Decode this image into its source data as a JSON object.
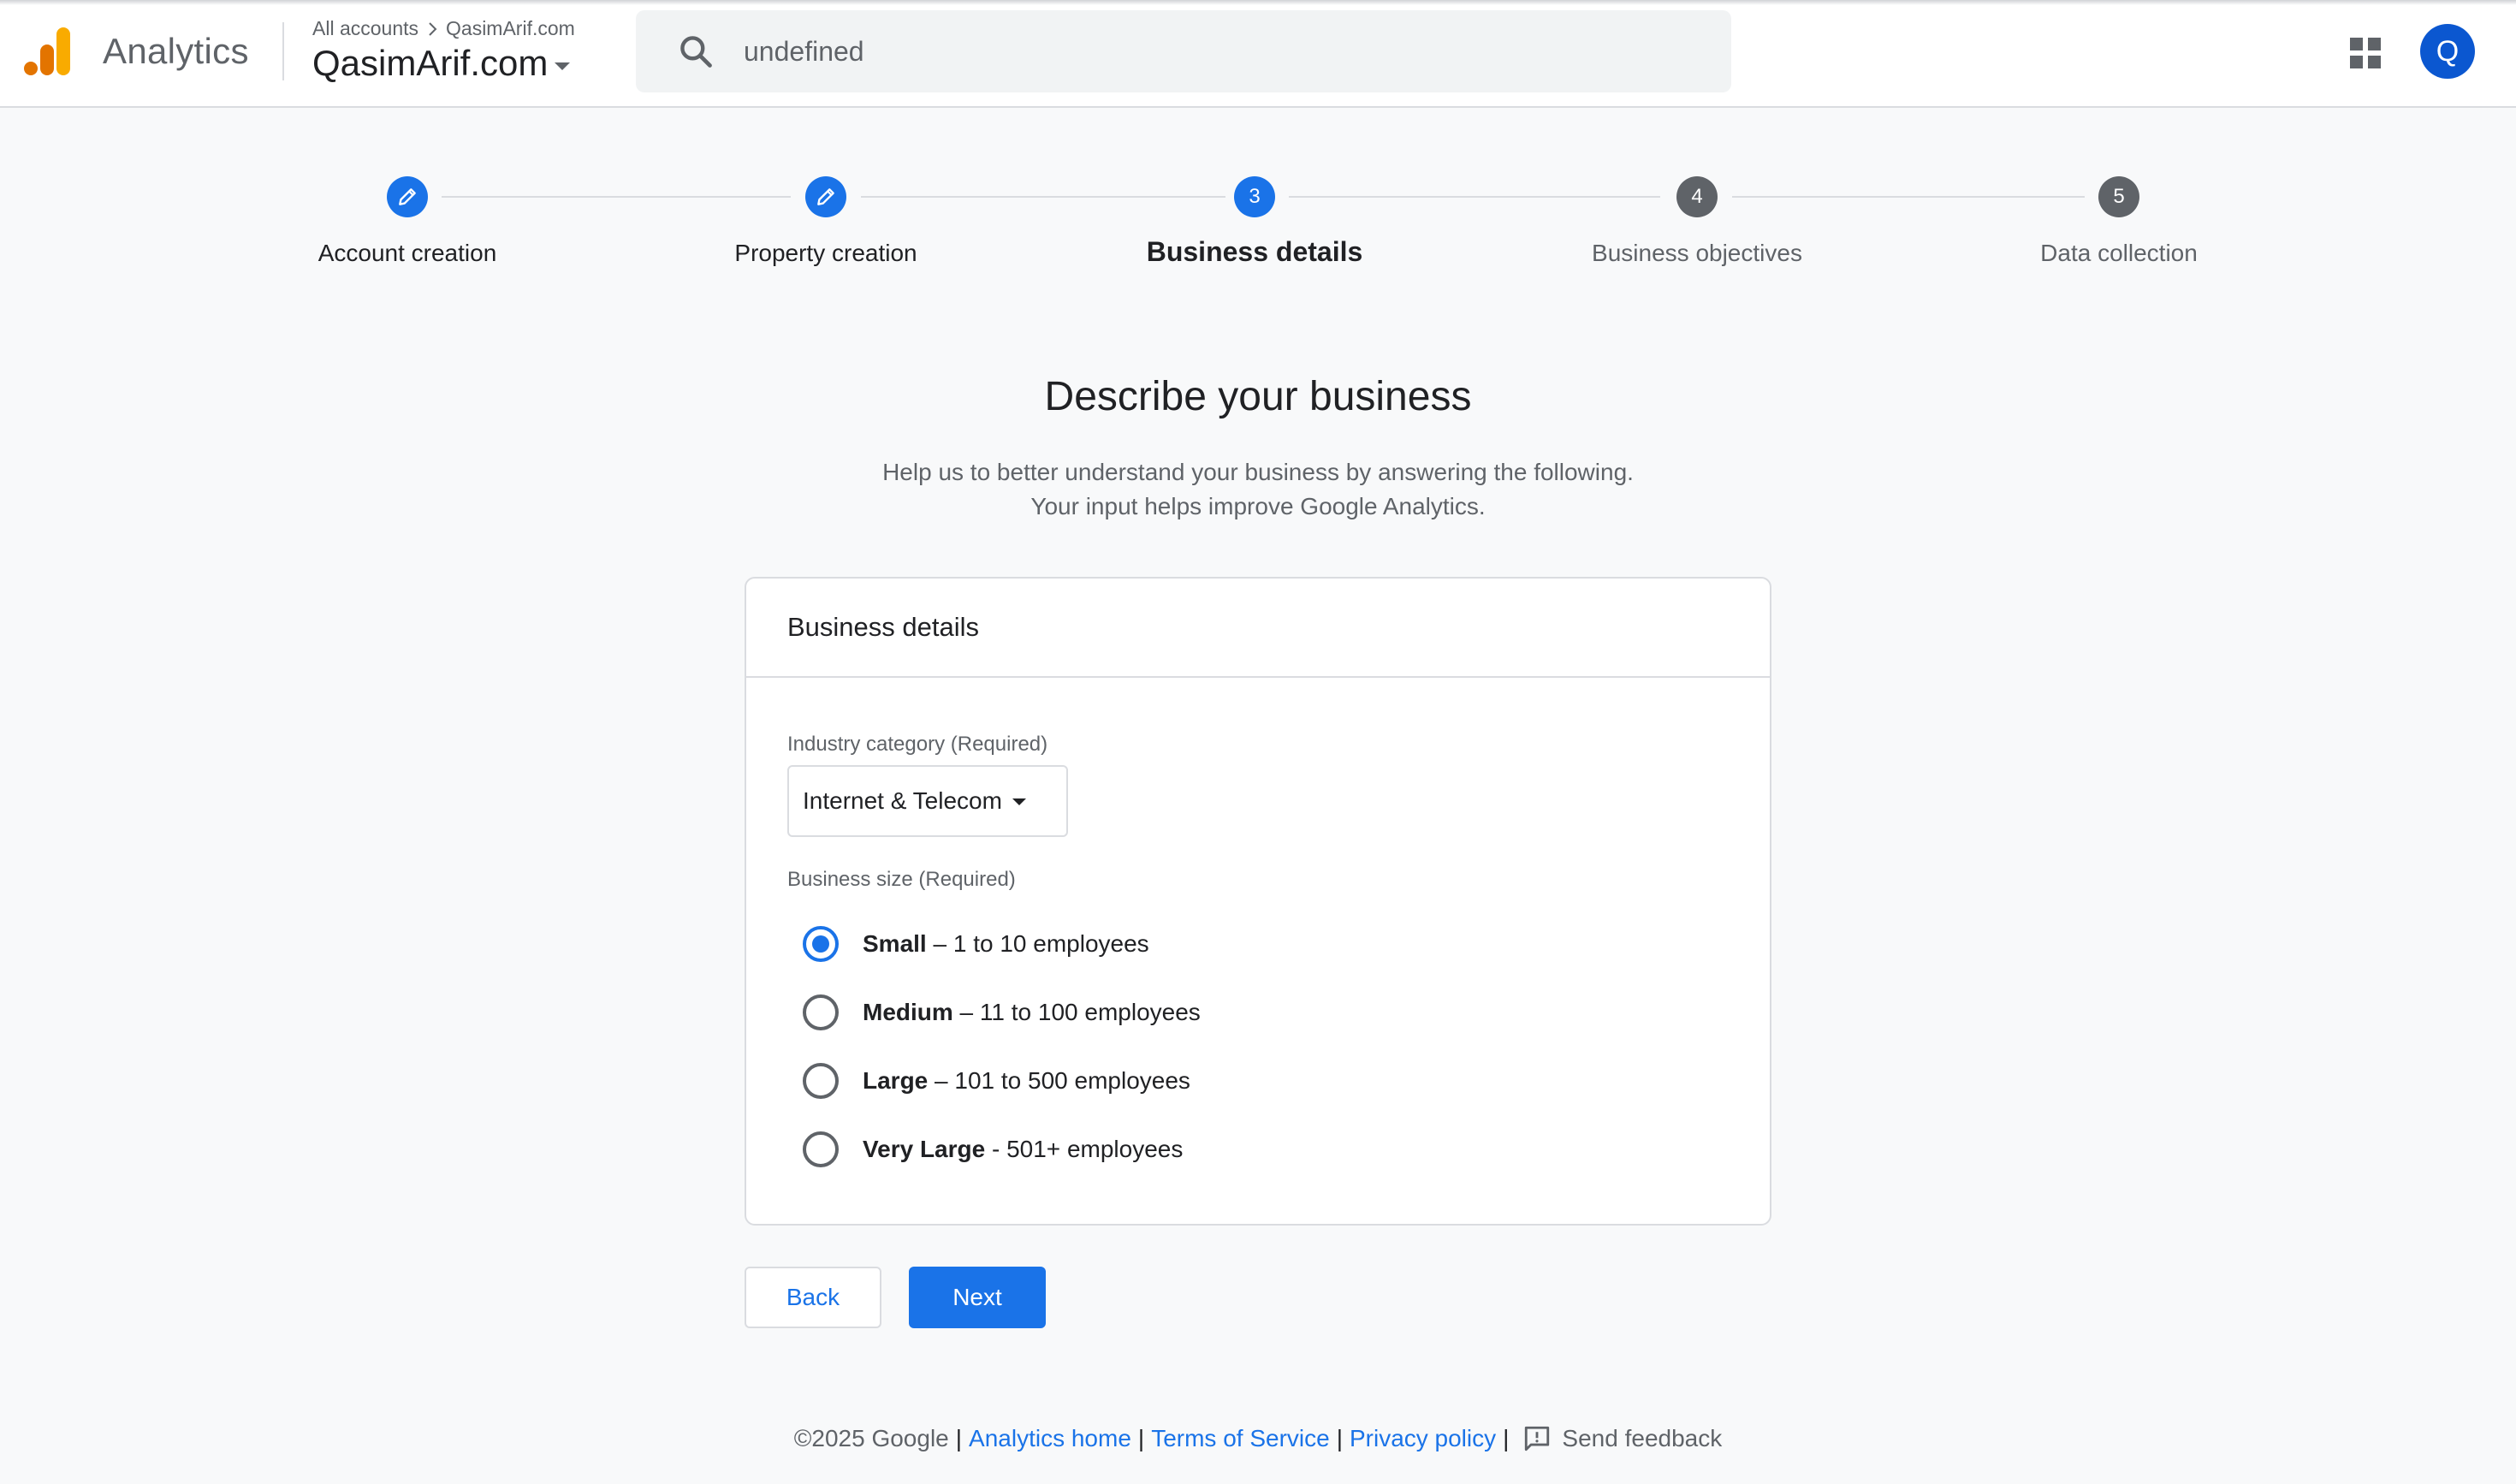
{
  "header": {
    "product_name": "Analytics",
    "breadcrumb_root": "All accounts",
    "breadcrumb_account": "QasimArif.com",
    "property_name": "QasimArif.com",
    "search_text": "undefined",
    "avatar_letter": "Q",
    "logo_icon": "analytics-bars-icon"
  },
  "stepper": {
    "steps": [
      {
        "label": "Account creation",
        "state": "done"
      },
      {
        "label": "Property creation",
        "state": "done"
      },
      {
        "label": "Business details",
        "state": "active",
        "number": "3"
      },
      {
        "label": "Business objectives",
        "state": "todo",
        "number": "4"
      },
      {
        "label": "Data collection",
        "state": "todo",
        "number": "5"
      }
    ]
  },
  "main": {
    "title": "Describe your business",
    "subtitle_line1": "Help us to better understand your business by answering the following.",
    "subtitle_line2": "Your input helps improve Google Analytics."
  },
  "card": {
    "header": "Business details",
    "industry_label": "Industry category (Required)",
    "industry_value": "Internet & Telecom",
    "size_label": "Business size (Required)",
    "size_options": [
      {
        "name": "Small",
        "sep": " – ",
        "range": "1 to 10 employees",
        "checked": true
      },
      {
        "name": "Medium",
        "sep": " – ",
        "range": "11 to 100 employees",
        "checked": false
      },
      {
        "name": "Large",
        "sep": " – ",
        "range": "101 to 500 employees",
        "checked": false
      },
      {
        "name": "Very Large",
        "sep": " - ",
        "range": "501+ employees",
        "checked": false
      }
    ]
  },
  "buttons": {
    "back": "Back",
    "next": "Next"
  },
  "footer": {
    "copyright": "©2025 Google",
    "analytics_home": "Analytics home",
    "terms": "Terms of Service",
    "privacy": "Privacy policy",
    "feedback": "Send feedback",
    "separator": "|"
  },
  "colors": {
    "accent": "#1a73e8",
    "logo_orange": "#f9ab00",
    "logo_dark_orange": "#e37400",
    "avatar": "#0b57d0"
  }
}
